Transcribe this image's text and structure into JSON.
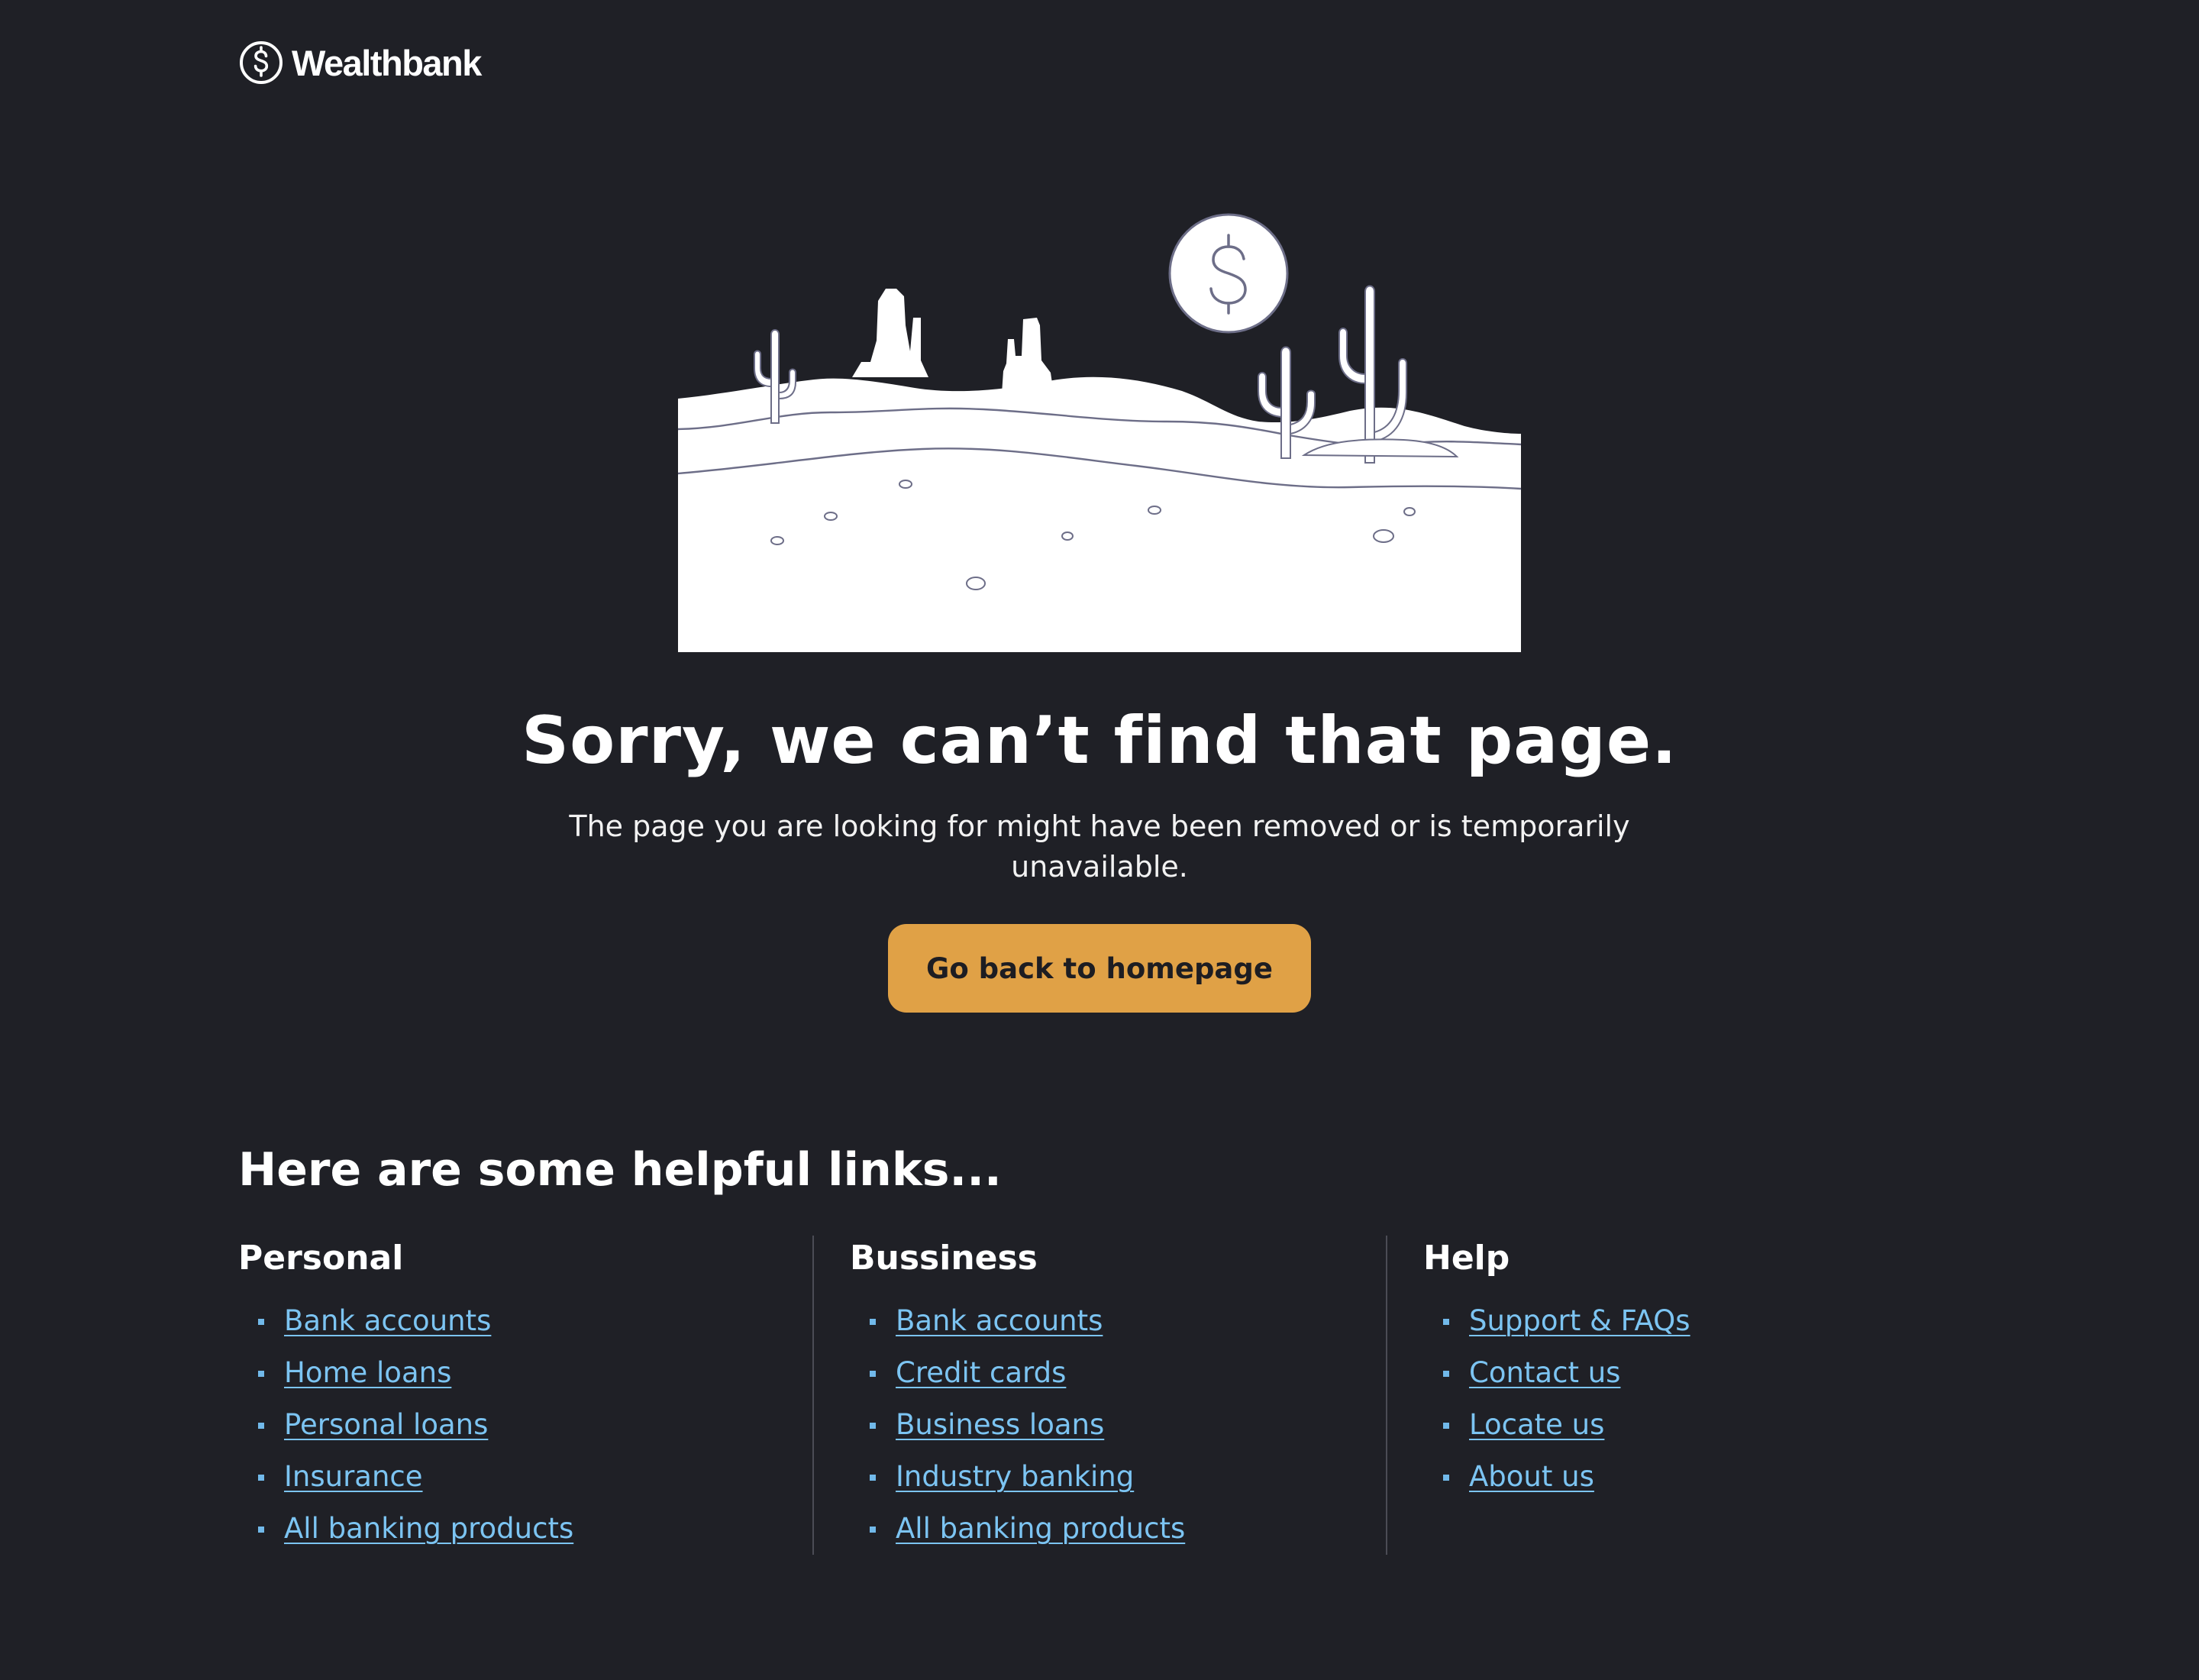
{
  "brand": {
    "name": "Wealthbank",
    "logo_icon": "dollar-circle-icon"
  },
  "illustration": {
    "description_icon": "desert-landscape-illustration",
    "sun_icon": "dollar-circle-icon"
  },
  "error": {
    "title": "Sorry, we can’t find that page.",
    "message": "The page you are looking for might have been removed or is temporarily unavailable.",
    "button_label": "Go back to homepage"
  },
  "links": {
    "heading": "Here are some helpful links...",
    "columns": [
      {
        "title": "Personal",
        "items": [
          "Bank accounts",
          "Home loans",
          "Personal loans",
          "Insurance",
          "All banking products"
        ]
      },
      {
        "title": "Bussiness",
        "items": [
          "Bank accounts",
          "Credit cards",
          "Business loans",
          "Industry banking",
          "All banking products"
        ]
      },
      {
        "title": "Help",
        "items": [
          "Support & FAQs",
          "Contact us",
          "Locate us",
          "About us"
        ]
      }
    ]
  },
  "colors": {
    "background": "#1f2026",
    "accent_button": "#e0a146",
    "link": "#7cc4f2",
    "illustration_fill": "#ffffff",
    "illustration_stroke": "#6d6e88"
  }
}
